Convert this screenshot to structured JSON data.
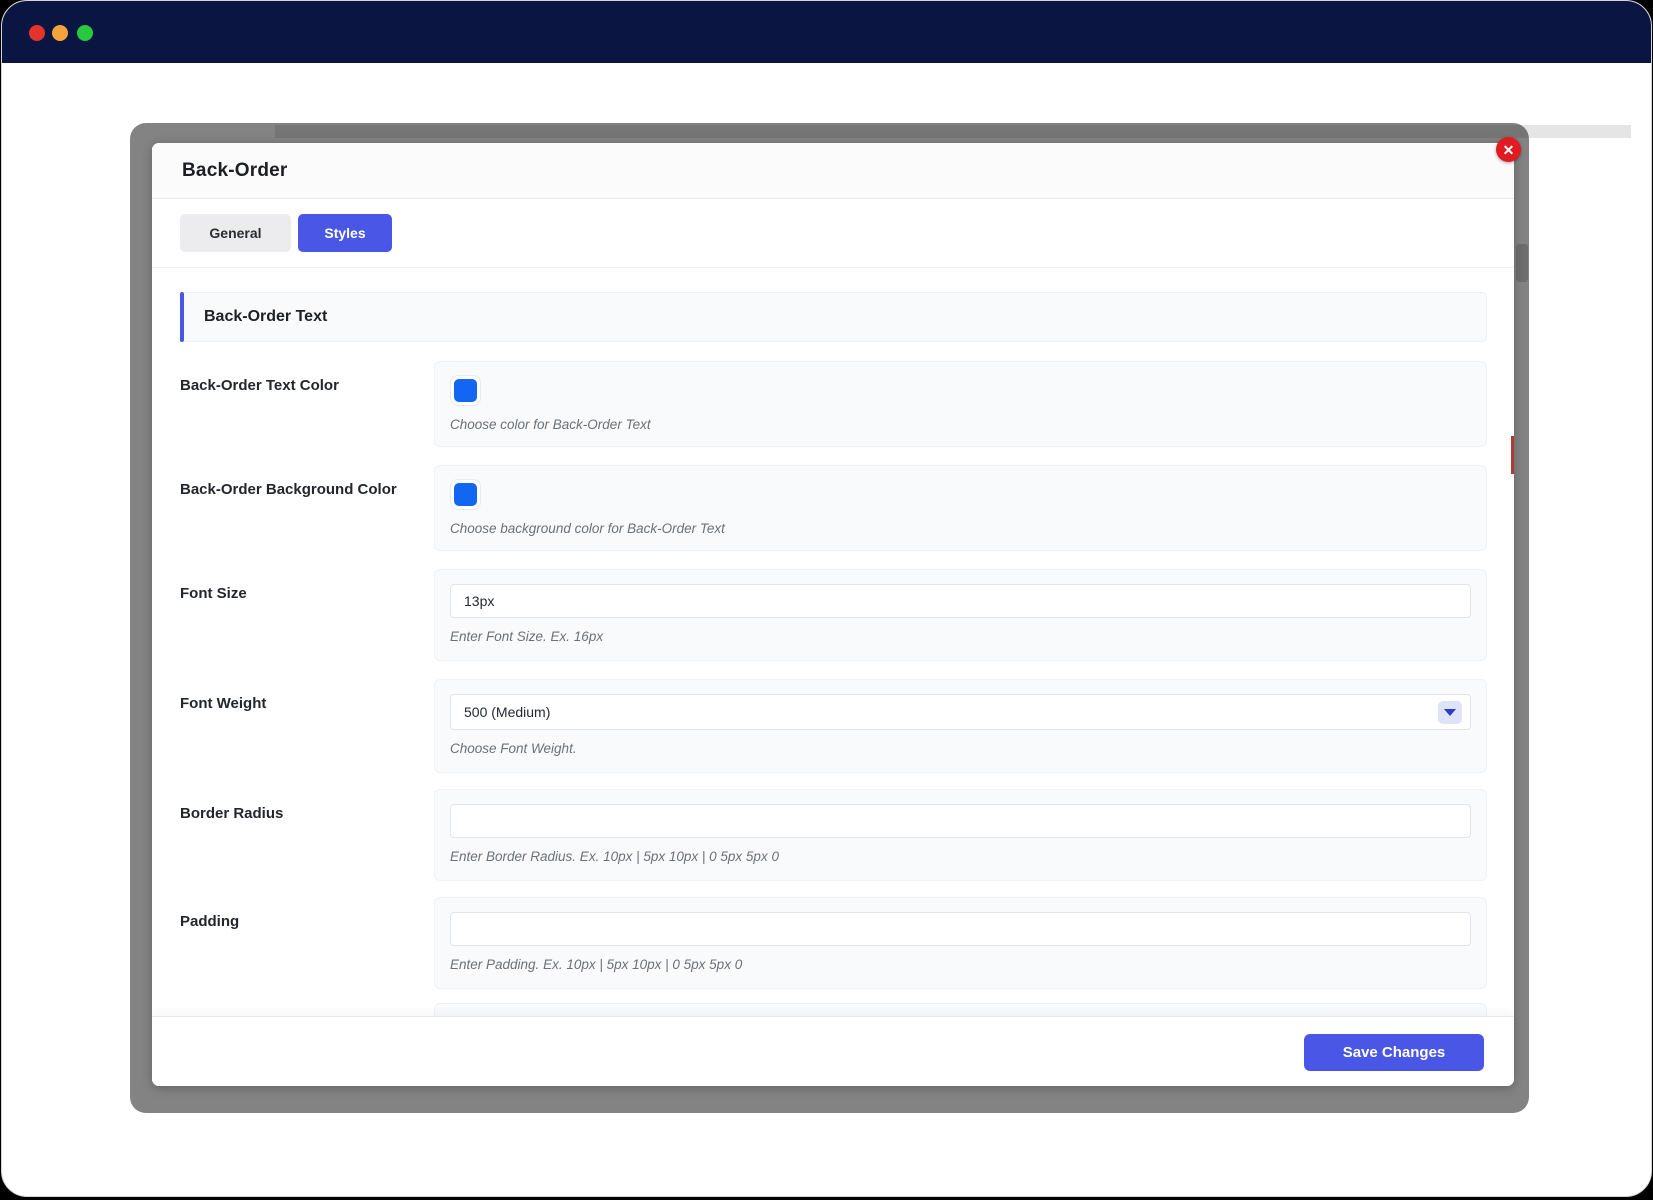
{
  "window": {
    "titlebar_color": "#0a1541",
    "traffic_lights": [
      {
        "name": "close",
        "color": "#e3342b"
      },
      {
        "name": "minimize",
        "color": "#f2a33c"
      },
      {
        "name": "zoom",
        "color": "#27c93f"
      }
    ]
  },
  "modal": {
    "title": "Back-Order",
    "close_label": "✕",
    "tabs": [
      {
        "label": "General",
        "active": false
      },
      {
        "label": "Styles",
        "active": true
      }
    ],
    "section": {
      "title": "Back-Order Text"
    },
    "rows": [
      {
        "label": "Back-Order Text Color",
        "type": "color",
        "swatch_color": "#1266f1",
        "caption": "Choose color for Back-Order Text"
      },
      {
        "label": "Back-Order Background Color",
        "type": "color",
        "swatch_color": "#1266f1",
        "caption": "Choose background color for Back-Order Text"
      },
      {
        "label": "Font Size",
        "type": "text",
        "value": "13px",
        "caption": "Enter Font Size. Ex. 16px"
      },
      {
        "label": "Font Weight",
        "type": "select",
        "value": "500 (Medium)",
        "caption": "Choose Font Weight."
      },
      {
        "label": "Border Radius",
        "type": "text",
        "value": "",
        "caption": "Enter Border Radius. Ex. 10px | 5px 10px | 0 5px 5px 0"
      },
      {
        "label": "Padding",
        "type": "text",
        "value": "",
        "caption": "Enter Padding. Ex. 10px | 5px 10px | 0 5px 5px 0"
      }
    ],
    "footer": {
      "save_label": "Save Changes"
    }
  },
  "colors": {
    "accent_indigo": "#4a57e6",
    "swatch_blue": "#1266f1",
    "close_red": "#e11b22",
    "frame_gray": "#838383"
  }
}
